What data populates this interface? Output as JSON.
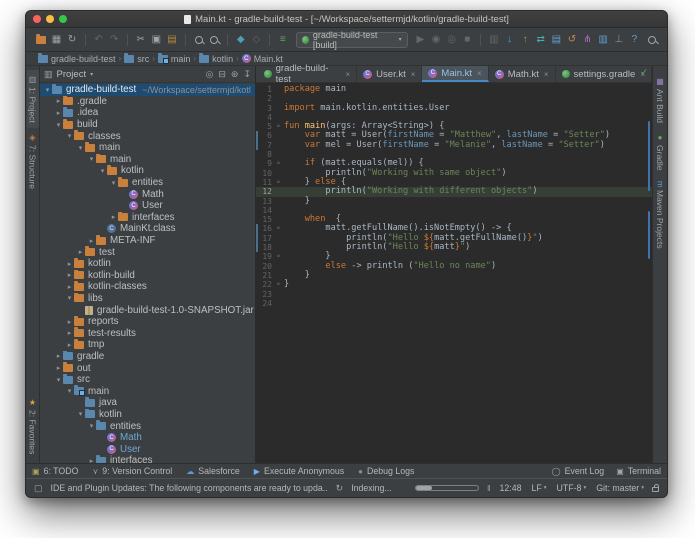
{
  "window": {
    "title": "Main.kt - gradle-build-test - [~/Workspace/settermjd/kotlin/gradle-build-test]"
  },
  "colors": {
    "accent_blue": "#4a88c7",
    "selection_blue": "#1e4b72",
    "editor_bg": "#2b2b2b",
    "panel_bg": "#3c3f41",
    "keyword_orange": "#cc7832",
    "string_green": "#6a8759",
    "param_blue": "#6897bb"
  },
  "toolbar": {
    "run_config": "gradle-build-test [build]",
    "items": [
      {
        "name": "open-file-icon",
        "glyph": "folder",
        "color": "#c9803d"
      },
      {
        "name": "save-icon",
        "glyph": "▦",
        "color": "#9fa4a8"
      },
      {
        "name": "sync-icon",
        "glyph": "↻",
        "color": "#9fa4a8"
      },
      {
        "name": "separator",
        "glyph": "sep"
      },
      {
        "name": "undo-icon",
        "glyph": "↶",
        "color": "#63676a"
      },
      {
        "name": "redo-icon",
        "glyph": "↷",
        "color": "#63676a"
      },
      {
        "name": "separator",
        "glyph": "sep"
      },
      {
        "name": "cut-icon",
        "glyph": "✂",
        "color": "#9fa4a8"
      },
      {
        "name": "copy-icon",
        "glyph": "▣",
        "color": "#9fa4a8"
      },
      {
        "name": "paste-icon",
        "glyph": "▤",
        "color": "#b5893c"
      },
      {
        "name": "separator",
        "glyph": "sep"
      },
      {
        "name": "find-icon",
        "glyph": "mag"
      },
      {
        "name": "replace-icon",
        "glyph": "mag"
      },
      {
        "name": "separator",
        "glyph": "sep"
      },
      {
        "name": "back-icon",
        "glyph": "◆",
        "color": "#4aa0b5"
      },
      {
        "name": "forward-icon",
        "glyph": "◇",
        "color": "#63676a"
      },
      {
        "name": "separator",
        "glyph": "sep"
      },
      {
        "name": "compile-icon",
        "glyph": "≡",
        "color": "#62a658"
      },
      {
        "name": "run-config-select",
        "glyph": "runcfg"
      },
      {
        "name": "run-icon",
        "glyph": "▶",
        "color": "#63676a"
      },
      {
        "name": "debug-icon",
        "glyph": "◉",
        "color": "#63676a"
      },
      {
        "name": "coverage-icon",
        "glyph": "◎",
        "color": "#63676a"
      },
      {
        "name": "stop-icon",
        "glyph": "■",
        "color": "#63676a"
      },
      {
        "name": "separator",
        "glyph": "sep"
      },
      {
        "name": "show-changes-icon",
        "glyph": "▥",
        "color": "#63676a"
      },
      {
        "name": "update-project-icon",
        "glyph": "↓",
        "color": "#4e9fdd"
      },
      {
        "name": "commit-icon",
        "glyph": "↑",
        "color": "#70b04a"
      },
      {
        "name": "compare-icon",
        "glyph": "⇄",
        "color": "#45b0a6"
      },
      {
        "name": "changelist-icon",
        "glyph": "▤",
        "color": "#5da0d0"
      },
      {
        "name": "rollback-icon",
        "glyph": "↺",
        "color": "#d08b4c"
      },
      {
        "name": "branch-icon",
        "glyph": "⋔",
        "color": "#b06cc4"
      },
      {
        "name": "patch-icon",
        "glyph": "▥",
        "color": "#5da0d0"
      },
      {
        "name": "annotate-icon",
        "glyph": "⊥",
        "color": "#8a8e91"
      },
      {
        "name": "help-icon",
        "glyph": "?",
        "color": "#5c9fd8"
      }
    ]
  },
  "breadcrumb": {
    "items": [
      {
        "label": "gradle-build-test",
        "icon": "fb"
      },
      {
        "label": "src",
        "icon": "fb"
      },
      {
        "label": "main",
        "icon": "sr"
      },
      {
        "label": "kotlin",
        "icon": "fb"
      },
      {
        "label": "Main.kt",
        "icon": "kc"
      }
    ]
  },
  "left_stripe": {
    "top": [
      {
        "label": "1: Project",
        "icon": "▥",
        "color": "#8aa0b0",
        "active": true
      },
      {
        "label": "7: Structure",
        "icon": "◈",
        "color": "#c77d41",
        "active": false
      }
    ],
    "bottom": [
      {
        "label": "2: Favorites",
        "icon": "★",
        "color": "#d6a53c",
        "active": false
      }
    ]
  },
  "right_stripe": {
    "items": [
      {
        "label": "Ant Build",
        "icon": "▦",
        "color": "#9f86c9"
      },
      {
        "label": "Gradle",
        "icon": "●",
        "color": "#62a658"
      },
      {
        "label": "Maven Projects",
        "icon": "m",
        "color": "#5b9bd5"
      }
    ]
  },
  "project_panel": {
    "title": "Project",
    "header_icons": [
      {
        "name": "locate-icon",
        "glyph": "◎"
      },
      {
        "name": "collapse-all-icon",
        "glyph": "⊟"
      },
      {
        "name": "settings-gear-icon",
        "glyph": "⊛"
      },
      {
        "name": "hide-panel-icon",
        "glyph": "↧"
      }
    ],
    "tree": [
      {
        "l": "gradle-build-test",
        "d": 0,
        "a": "e",
        "i": "fb",
        "sel": true,
        "x": "~/Workspace/settermjd/kotl"
      },
      {
        "l": ".gradle",
        "d": 1,
        "a": "c",
        "i": "fo"
      },
      {
        "l": ".idea",
        "d": 1,
        "a": "c",
        "i": "fb"
      },
      {
        "l": "build",
        "d": 1,
        "a": "e",
        "i": "fo"
      },
      {
        "l": "classes",
        "d": 2,
        "a": "e",
        "i": "fo"
      },
      {
        "l": "main",
        "d": 3,
        "a": "e",
        "i": "fo"
      },
      {
        "l": "main",
        "d": 4,
        "a": "e",
        "i": "fo"
      },
      {
        "l": "kotlin",
        "d": 5,
        "a": "e",
        "i": "fo"
      },
      {
        "l": "entities",
        "d": 6,
        "a": "e",
        "i": "fo"
      },
      {
        "l": "Math",
        "d": 7,
        "a": "n",
        "i": "kc"
      },
      {
        "l": "User",
        "d": 7,
        "a": "n",
        "i": "kc"
      },
      {
        "l": "interfaces",
        "d": 6,
        "a": "c",
        "i": "fo"
      },
      {
        "l": "MainKt.class",
        "d": 5,
        "a": "n",
        "i": "jc"
      },
      {
        "l": "META-INF",
        "d": 4,
        "a": "c",
        "i": "fo"
      },
      {
        "l": "test",
        "d": 3,
        "a": "c",
        "i": "fo"
      },
      {
        "l": "kotlin",
        "d": 2,
        "a": "c",
        "i": "fo"
      },
      {
        "l": "kotlin-build",
        "d": 2,
        "a": "c",
        "i": "fo"
      },
      {
        "l": "kotlin-classes",
        "d": 2,
        "a": "c",
        "i": "fo"
      },
      {
        "l": "libs",
        "d": 2,
        "a": "e",
        "i": "fo"
      },
      {
        "l": "gradle-build-test-1.0-SNAPSHOT.jar",
        "d": 3,
        "a": "n",
        "i": "jar"
      },
      {
        "l": "reports",
        "d": 2,
        "a": "c",
        "i": "fo"
      },
      {
        "l": "test-results",
        "d": 2,
        "a": "c",
        "i": "fo"
      },
      {
        "l": "tmp",
        "d": 2,
        "a": "c",
        "i": "fo"
      },
      {
        "l": "gradle",
        "d": 1,
        "a": "c",
        "i": "fb"
      },
      {
        "l": "out",
        "d": 1,
        "a": "c",
        "i": "fo"
      },
      {
        "l": "src",
        "d": 1,
        "a": "e",
        "i": "fb"
      },
      {
        "l": "main",
        "d": 2,
        "a": "e",
        "i": "sr"
      },
      {
        "l": "java",
        "d": 3,
        "a": "n",
        "i": "fb"
      },
      {
        "l": "kotlin",
        "d": 3,
        "a": "e",
        "i": "fb"
      },
      {
        "l": "entities",
        "d": 4,
        "a": "e",
        "i": "fb"
      },
      {
        "l": "Math",
        "d": 5,
        "a": "n",
        "i": "kc",
        "blue": true
      },
      {
        "l": "User",
        "d": 5,
        "a": "n",
        "i": "kc",
        "blue": true
      },
      {
        "l": "interfaces",
        "d": 4,
        "a": "c",
        "i": "fb"
      }
    ]
  },
  "editor": {
    "tabs": [
      {
        "label": "gradle-build-test",
        "icon": "gr",
        "active": false
      },
      {
        "label": "User.kt",
        "icon": "kc",
        "active": false
      },
      {
        "label": "Main.kt",
        "icon": "kc",
        "active": true
      },
      {
        "label": "Math.kt",
        "icon": "kc",
        "active": false
      },
      {
        "label": "settings.gradle",
        "icon": "gr",
        "active": false
      }
    ],
    "inspection_status": "✓",
    "lines": [
      {
        "n": 1,
        "s": [
          [
            "package",
            "kw"
          ],
          [
            " main",
            "pl"
          ]
        ]
      },
      {
        "n": 2,
        "s": []
      },
      {
        "n": 3,
        "s": [
          [
            "import",
            "kw"
          ],
          [
            " main.kotlin.entities.User",
            "pl"
          ]
        ]
      },
      {
        "n": 4,
        "s": []
      },
      {
        "n": 5,
        "fm": true,
        "s": [
          [
            "fun",
            "kw"
          ],
          [
            " ",
            "pl"
          ],
          [
            "main",
            "fn"
          ],
          [
            "(args: Array<String>) {",
            "pl"
          ]
        ]
      },
      {
        "n": 6,
        "chg": true,
        "s": [
          [
            "    ",
            "pl"
          ],
          [
            "var",
            "kw"
          ],
          [
            " matt = User(",
            "pl"
          ],
          [
            "firstName",
            "np"
          ],
          [
            " = ",
            "pl"
          ],
          [
            "\"Matthew\"",
            "str"
          ],
          [
            ", ",
            "pl"
          ],
          [
            "lastName",
            "np"
          ],
          [
            " = ",
            "pl"
          ],
          [
            "\"Setter\"",
            "str"
          ],
          [
            ")",
            "pl"
          ]
        ]
      },
      {
        "n": 7,
        "chg": true,
        "s": [
          [
            "    ",
            "pl"
          ],
          [
            "var",
            "kw"
          ],
          [
            " mel = User(",
            "pl"
          ],
          [
            "firstName",
            "np"
          ],
          [
            " = ",
            "pl"
          ],
          [
            "\"Melanie\"",
            "str"
          ],
          [
            ", ",
            "pl"
          ],
          [
            "lastName",
            "np"
          ],
          [
            " = ",
            "pl"
          ],
          [
            "\"Setter\"",
            "str"
          ],
          [
            ")",
            "pl"
          ]
        ]
      },
      {
        "n": 8,
        "s": []
      },
      {
        "n": 9,
        "fm": true,
        "s": [
          [
            "    ",
            "pl"
          ],
          [
            "if",
            "kw"
          ],
          [
            " (matt.equals(mel)) {",
            "pl"
          ]
        ]
      },
      {
        "n": 10,
        "s": [
          [
            "        println(",
            "pl"
          ],
          [
            "\"Working with same object\"",
            "str"
          ],
          [
            ")",
            "pl"
          ]
        ]
      },
      {
        "n": 11,
        "fm": true,
        "s": [
          [
            "    } ",
            "pl"
          ],
          [
            "else",
            "kw"
          ],
          [
            " {",
            "pl"
          ]
        ]
      },
      {
        "n": 12,
        "hl": true,
        "s": [
          [
            "        println(",
            "pl"
          ],
          [
            "\"Working with different objects\"",
            "str"
          ],
          [
            ")",
            "pl"
          ]
        ]
      },
      {
        "n": 13,
        "s": [
          [
            "    }",
            "pl"
          ]
        ]
      },
      {
        "n": 14,
        "s": []
      },
      {
        "n": 15,
        "s": [
          [
            "    ",
            "pl"
          ],
          [
            "when",
            "kw"
          ],
          [
            "  {",
            "pl"
          ]
        ]
      },
      {
        "n": 16,
        "fm": true,
        "chg": true,
        "s": [
          [
            "        matt.getFullName().isNotEmpty() -> {",
            "pl"
          ]
        ]
      },
      {
        "n": 17,
        "chg": true,
        "s": [
          [
            "            println(",
            "pl"
          ],
          [
            "\"Hello ",
            "str"
          ],
          [
            "${",
            "tpl"
          ],
          [
            "matt.getFullName()",
            "pl"
          ],
          [
            "}",
            "tpl"
          ],
          [
            "\"",
            "str"
          ],
          [
            ")",
            "pl"
          ]
        ]
      },
      {
        "n": 18,
        "chg": true,
        "s": [
          [
            "            println(",
            "pl"
          ],
          [
            "\"Hello ",
            "str"
          ],
          [
            "${",
            "tpl"
          ],
          [
            "matt",
            "pl"
          ],
          [
            "}",
            "tpl"
          ],
          [
            "\"",
            "str"
          ],
          [
            ")",
            "pl"
          ]
        ]
      },
      {
        "n": 19,
        "fm": true,
        "s": [
          [
            "        }",
            "pl"
          ]
        ]
      },
      {
        "n": 20,
        "s": [
          [
            "        ",
            "pl"
          ],
          [
            "else",
            "kw"
          ],
          [
            " -> println (",
            "pl"
          ],
          [
            "\"Hello no name\"",
            "str"
          ],
          [
            ")",
            "pl"
          ]
        ]
      },
      {
        "n": 21,
        "s": [
          [
            "    }",
            "pl"
          ]
        ]
      },
      {
        "n": 22,
        "fm": true,
        "s": [
          [
            "}",
            "pl"
          ]
        ]
      },
      {
        "n": 23,
        "s": []
      },
      {
        "n": 24,
        "s": []
      }
    ]
  },
  "bottom_bar": {
    "left": [
      {
        "label": "6: TODO",
        "icon": "▣",
        "color": "#a8a558"
      },
      {
        "label": "9: Version Control",
        "icon": "⋎",
        "color": "#9fa4a8"
      },
      {
        "label": "Salesforce",
        "icon": "☁",
        "color": "#5b9bd5"
      },
      {
        "label": "Execute Anonymous",
        "icon": "▶",
        "color": "#6ab0f3"
      },
      {
        "label": "Debug Logs",
        "icon": "●",
        "color": "#8a8a8a"
      }
    ],
    "right": [
      {
        "label": "Event Log",
        "icon": "◯",
        "color": "#9fa4a8"
      },
      {
        "label": "Terminal",
        "icon": "▣",
        "color": "#9fa4a8"
      }
    ]
  },
  "status_bar": {
    "message": "IDE and Plugin Updates: The following components are ready to upda..",
    "indexing": "Indexing...",
    "right_items": [
      {
        "label": "12:48",
        "caret": false
      },
      {
        "label": "LF",
        "caret": true
      },
      {
        "label": "UTF-8",
        "caret": true
      },
      {
        "label": "Git: master",
        "caret": true
      }
    ]
  }
}
